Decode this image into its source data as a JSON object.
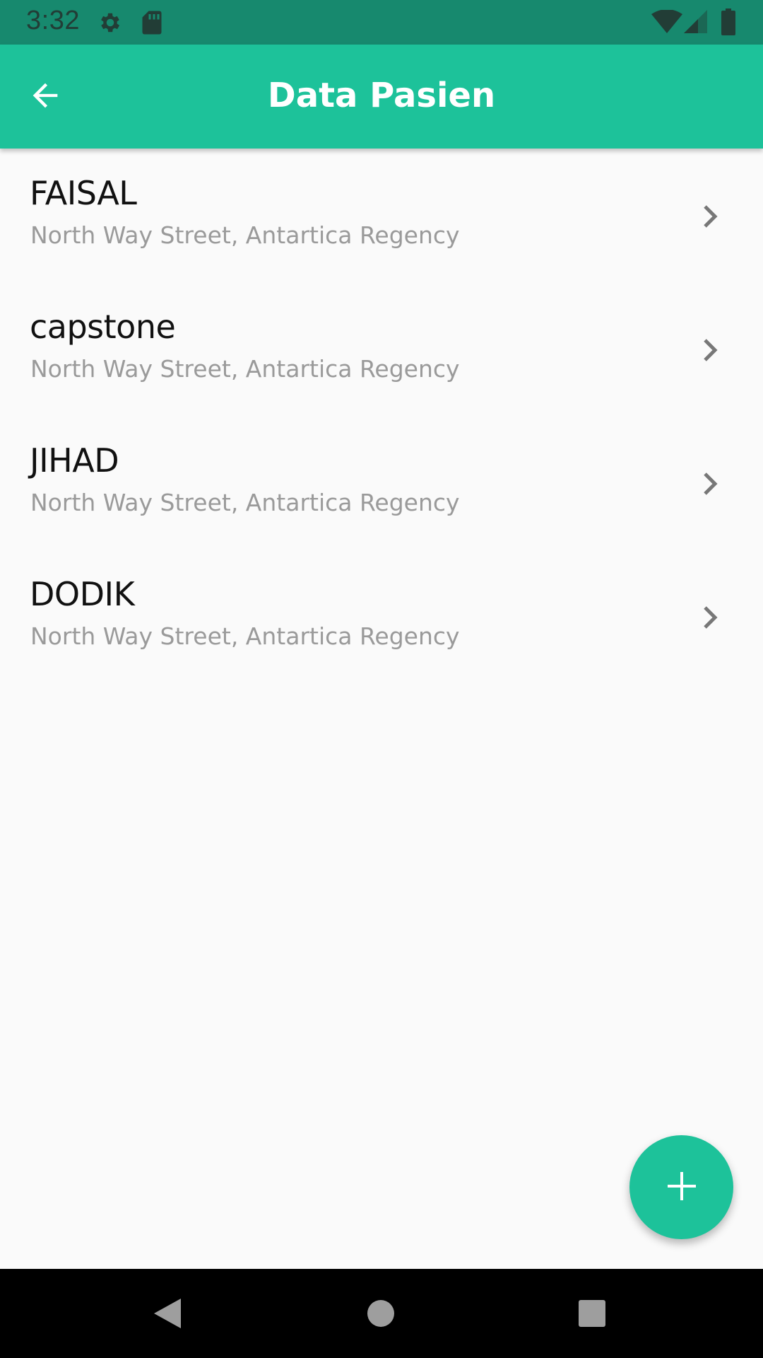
{
  "status_bar": {
    "time": "3:32",
    "icons": [
      "settings-icon",
      "sd-card-icon",
      "wifi-icon",
      "signal-icon",
      "battery-icon"
    ]
  },
  "app_bar": {
    "title": "Data Pasien",
    "back_icon": "arrow-back-icon"
  },
  "patients": [
    {
      "name": "FAISAL",
      "address": "North Way Street, Antartica Regency"
    },
    {
      "name": "capstone",
      "address": "North Way Street, Antartica Regency"
    },
    {
      "name": "JIHAD",
      "address": "North Way Street, Antartica Regency"
    },
    {
      "name": "DODIK",
      "address": "North Way Street, Antartica Regency"
    }
  ],
  "fab": {
    "icon": "plus-icon"
  },
  "nav_bar": {
    "buttons": [
      "back-triangle-icon",
      "home-circle-icon",
      "recents-square-icon"
    ]
  },
  "colors": {
    "primary": "#1dc29a",
    "status_bar": "#17896e",
    "background": "#fafafa",
    "name_text": "#111111",
    "address_text": "#9a9a9a"
  }
}
